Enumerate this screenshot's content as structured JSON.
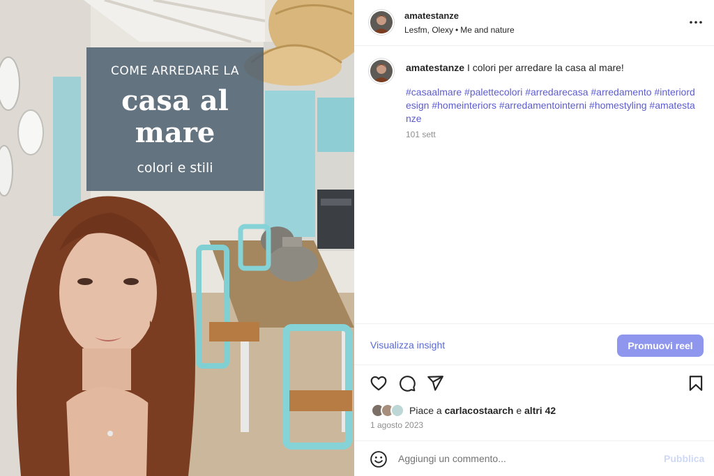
{
  "colors": {
    "accent": "#5a69d6",
    "hashtag": "#5c5ccf",
    "promote_button": "#8e96ee",
    "publish_disabled": "#cfd9f5",
    "overlay": "#4e6070"
  },
  "media": {
    "overlay_line1": "COME ARREDARE LA",
    "overlay_title_line1": "casa al",
    "overlay_title_line2": "mare",
    "overlay_subtitle": "colori e stili"
  },
  "header": {
    "username": "amatestanze",
    "audio": "Lesfm, Olexy",
    "separator": "•",
    "audio_track": "Me and nature",
    "more_icon": "more-horizontal-icon"
  },
  "caption": {
    "username": "amatestanze",
    "text": "I colori per arredare la casa al mare!",
    "hashtags": "#casaalmare #palettecolori #arredarecasa #arredamento #interiordesign #homeinteriors #arredamentointerni #homestyling #amatestanze",
    "time": "101 sett"
  },
  "insight": {
    "link_label": "Visualizza insight",
    "promote_label": "Promuovi reel"
  },
  "actions": {
    "icons": [
      "heart-icon",
      "comment-icon",
      "share-icon",
      "bookmark-icon"
    ]
  },
  "likes": {
    "prefix": "Piace a",
    "user": "carlacostaarch",
    "conjunction": "e",
    "others": "altri 42"
  },
  "post_date": "1 agosto 2023",
  "comment": {
    "placeholder": "Aggiungi un commento...",
    "publish_label": "Pubblica",
    "emoji_icon": "emoji-icon"
  }
}
